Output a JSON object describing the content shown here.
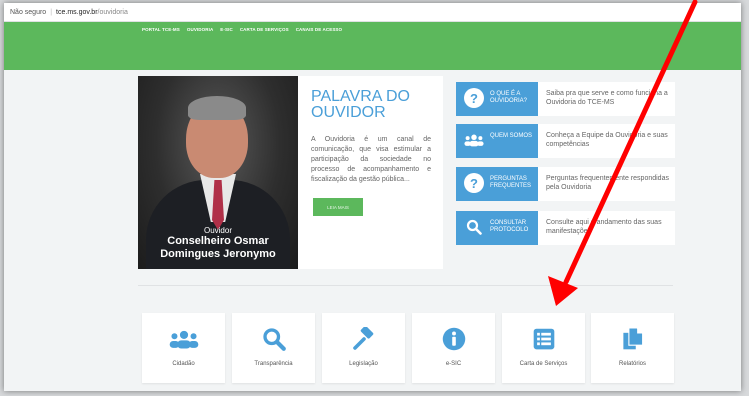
{
  "browser": {
    "security": "Não seguro",
    "host": "tce.ms.gov.br",
    "path": "/ouvidoria"
  },
  "nav": [
    "PORTAL TCE-MS",
    "OUVIDORIA",
    "E-SIC",
    "CARTA DE SERVIÇOS",
    "CANAIS DE ACESSO"
  ],
  "hero": {
    "caption_role": "Ouvidor",
    "caption_name_1": "Conselheiro Osmar",
    "caption_name_2": "Domingues Jeronymo",
    "title": "PALAVRA DO OUVIDOR",
    "description": "A Ouvidoria é um canal de comunicação, que visa estimular a participação da sociedade no processo de acompanhamento e fiscalização da gestão pública...",
    "read_more": "LEIA MAIS"
  },
  "cards": [
    {
      "label": "O QUE É A OUVIDORIA?",
      "desc": "Saiba pra que serve e como funciona a Ouvidoria do TCE-MS",
      "icon": "question-icon"
    },
    {
      "label": "QUEM SOMOS",
      "desc": "Conheça a Equipe da Ouvidoria e suas competências",
      "icon": "users-icon"
    },
    {
      "label": "PERGUNTAS FREQUENTES",
      "desc": "Perguntas frequentemente respondidas pela Ouvidoria",
      "icon": "question-icon"
    },
    {
      "label": "CONSULTAR PROTOCOLO",
      "desc": "Consulte aqui o andamento das suas manifestações",
      "icon": "search-icon"
    }
  ],
  "tiles": [
    {
      "label": "Cidadão",
      "icon": "users-icon"
    },
    {
      "label": "Transparência",
      "icon": "search-icon"
    },
    {
      "label": "Legislação",
      "icon": "gavel-icon"
    },
    {
      "label": "e-SIC",
      "icon": "info-icon"
    },
    {
      "label": "Carta de Serviços",
      "icon": "list-icon"
    },
    {
      "label": "Relatórios",
      "icon": "documents-icon"
    }
  ],
  "colors": {
    "accent_blue": "#4a9fd8",
    "nav_green": "#5cb85c",
    "arrow_red": "#ff0000"
  }
}
